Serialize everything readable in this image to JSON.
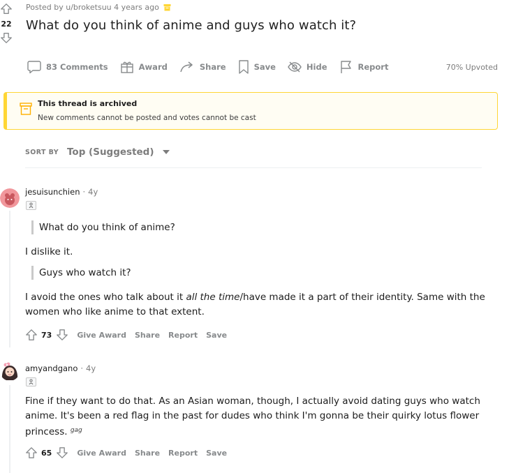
{
  "post": {
    "score": "22",
    "meta": "Posted by u/broketsuu 4 years ago",
    "title": "What do you think of anime and guys who watch it?",
    "actions": {
      "comments": "83 Comments",
      "award": "Award",
      "share": "Share",
      "save": "Save",
      "hide": "Hide",
      "report": "Report"
    },
    "upvoted": "70% Upvoted"
  },
  "archived": {
    "title": "This thread is archived",
    "subtitle": "New comments cannot be posted and votes cannot be cast"
  },
  "sort": {
    "label": "SORT BY",
    "value": "Top (Suggested)"
  },
  "comments": [
    {
      "author": "jesuisunchien",
      "time": "4y",
      "quote1": "What do you think of anime?",
      "reply1": "I dislike it.",
      "quote2": "Guys who watch it?",
      "reply2_a": "I avoid the ones who talk about it ",
      "reply2_em": "all the time",
      "reply2_b": "/have made it a part of their identity. Same with the women who like anime to that extent.",
      "score": "73",
      "actions": {
        "give_award": "Give Award",
        "share": "Share",
        "report": "Report",
        "save": "Save"
      }
    },
    {
      "author": "amyandgano",
      "time": "4y",
      "text": "Fine if they want to do that. As an Asian woman, though, I actually avoid dating guys who watch anime. It's been a red flag in the past for dudes who think I'm gonna be their quirky lotus flower princess.",
      "text_sup": "gag",
      "score": "65",
      "actions": {
        "give_award": "Give Award",
        "share": "Share",
        "report": "Report",
        "save": "Save"
      }
    }
  ],
  "colors": {
    "archived_border": "#ffd635",
    "meta_gray": "#7c7c7c",
    "action_gray": "#878a8c",
    "avatar1": "#f1979c",
    "avatar2": "#3a2a2a"
  },
  "icons": {
    "upvote": "upvote-arrow-icon",
    "downvote": "downvote-arrow-icon",
    "archive": "archive-box-icon",
    "comment": "comment-bubble-icon",
    "award": "gift-icon",
    "share": "share-arrow-icon",
    "save": "bookmark-icon",
    "hide": "eye-slash-icon",
    "report": "flag-icon",
    "dropdown": "caret-down-icon"
  }
}
